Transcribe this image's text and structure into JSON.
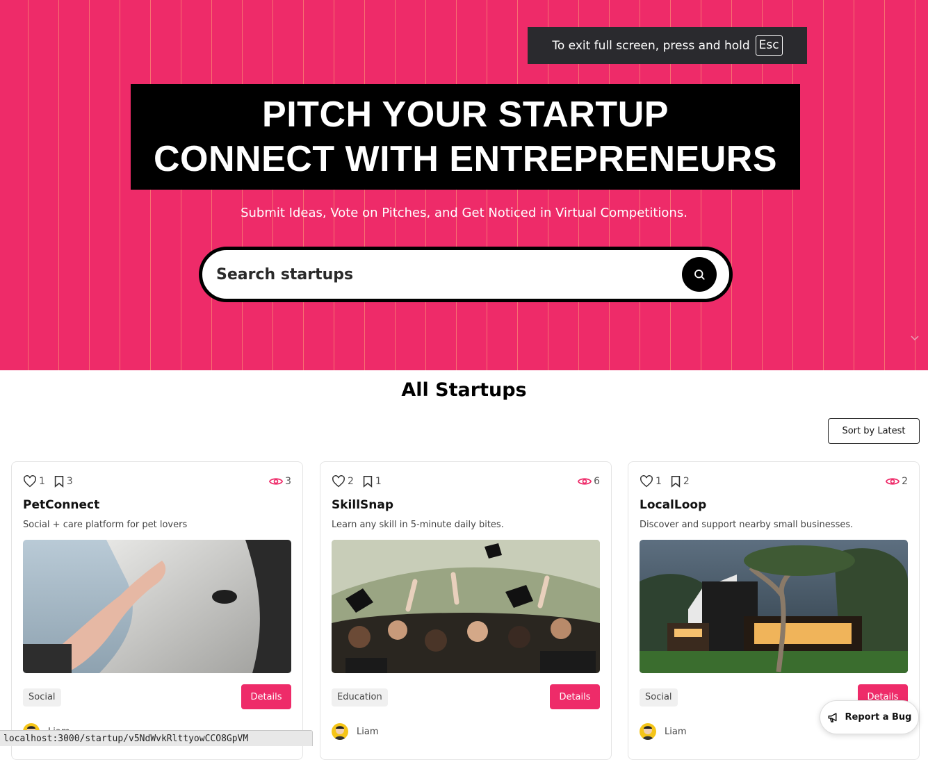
{
  "fullscreen_notice": {
    "text": "To exit full screen, press and hold",
    "key": "Esc"
  },
  "hero": {
    "headline_line1": "PITCH YOUR STARTUP",
    "headline_line2": "CONNECT WITH ENTREPRENEURS",
    "subheading": "Submit Ideas, Vote on Pitches, and Get Noticed in Virtual Competitions.",
    "search_placeholder": "Search startups"
  },
  "section": {
    "title": "All Startups",
    "sort_label": "Sort by Latest"
  },
  "colors": {
    "brand": "#ee2b69",
    "dark": "#000000"
  },
  "startups": [
    {
      "likes": "1",
      "bookmarks": "3",
      "views": "3",
      "title": "PetConnect",
      "description": "Social + care platform for pet lovers",
      "category": "Social",
      "details_label": "Details",
      "author": "Liam"
    },
    {
      "likes": "2",
      "bookmarks": "1",
      "views": "6",
      "title": "SkillSnap",
      "description": "Learn any skill in 5-minute daily bites.",
      "category": "Education",
      "details_label": "Details",
      "author": "Liam"
    },
    {
      "likes": "1",
      "bookmarks": "2",
      "views": "2",
      "title": "LocalLoop",
      "description": "Discover and support nearby small businesses.",
      "category": "Social",
      "details_label": "Details",
      "author": "Liam"
    }
  ],
  "status_bar": {
    "url": "localhost:3000/startup/v5NdWvkRlttyowCCO8GpVM"
  },
  "report_bug": {
    "label": "Report a Bug"
  }
}
